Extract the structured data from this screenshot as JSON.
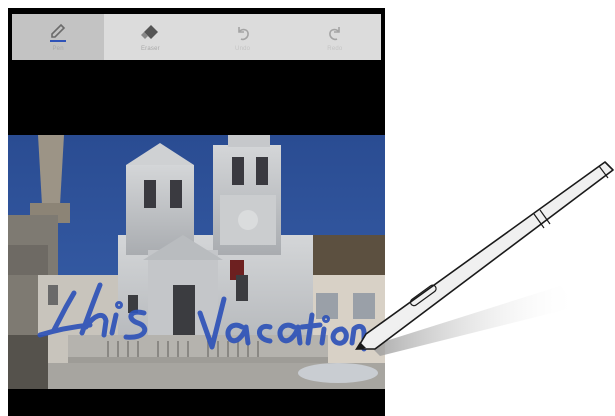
{
  "toolbar": {
    "pen_label": "Pen",
    "eraser_label": "Eraser",
    "undo_label": "Undo",
    "redo_label": "Redo"
  },
  "handwriting": {
    "text": "this Vacation",
    "color": "#2f53b8"
  },
  "colors": {
    "toolbar_bg": "#dcdcdc",
    "toolbar_active": "#c3c3c3",
    "pen_ink": "#2f53b8",
    "sky": "#2c4f97"
  },
  "icons": {
    "pen": "pen-icon",
    "eraser": "eraser-icon",
    "undo": "undo-icon",
    "redo": "redo-icon"
  }
}
